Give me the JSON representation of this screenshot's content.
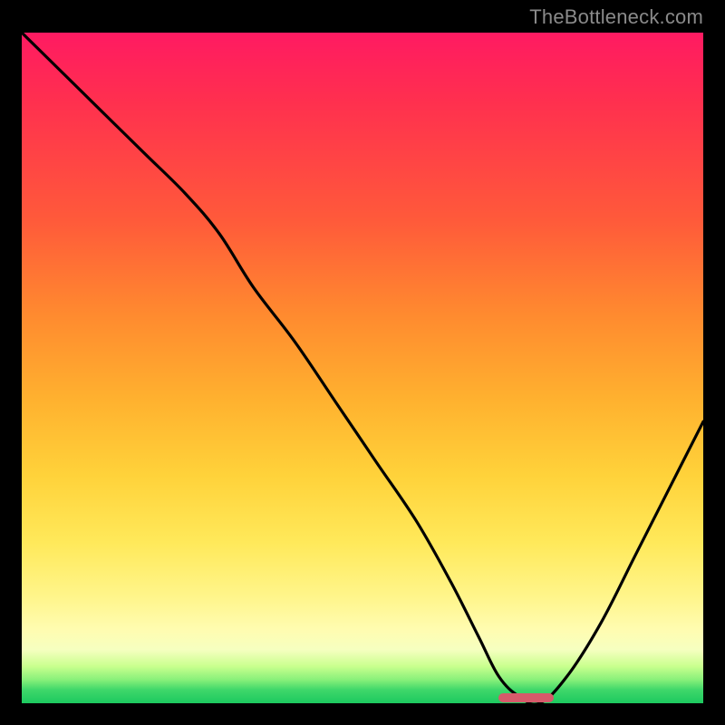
{
  "watermark": {
    "text": "TheBottleneck.com"
  },
  "colors": {
    "curve": "#000000",
    "marker": "#d65a6a",
    "frame_bg": "#000000"
  },
  "chart_data": {
    "type": "line",
    "title": "",
    "xlabel": "",
    "ylabel": "",
    "xlim": [
      0,
      100
    ],
    "ylim": [
      0,
      100
    ],
    "grid": false,
    "legend": false,
    "series": [
      {
        "name": "bottleneck-curve",
        "x": [
          0,
          6,
          12,
          18,
          24,
          29,
          34,
          40,
          46,
          52,
          58,
          63,
          67,
          70,
          73,
          76,
          80,
          85,
          90,
          95,
          100
        ],
        "y": [
          100,
          94,
          88,
          82,
          76,
          70,
          62,
          54,
          45,
          36,
          27,
          18,
          10,
          4,
          1,
          0,
          4,
          12,
          22,
          32,
          42
        ]
      }
    ],
    "marker": {
      "x_start": 70,
      "x_end": 78,
      "y": 0
    },
    "notes": "y is read from the vertical position of the black curve as a percentage of plot height (0 = bottom edge, 100 = top edge). No axis ticks are visible; values are estimated from pixel position."
  }
}
